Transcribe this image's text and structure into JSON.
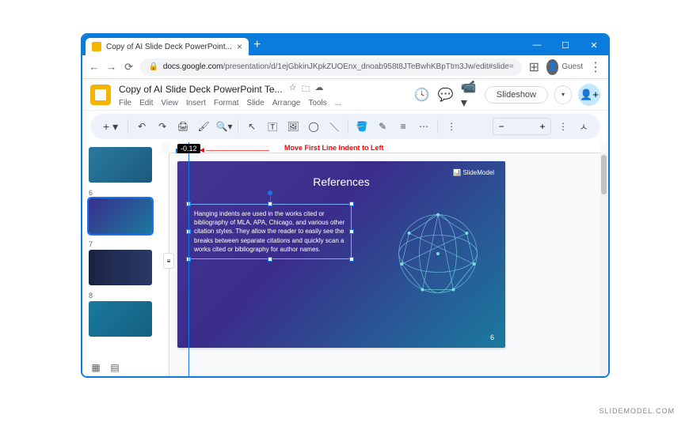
{
  "browser": {
    "tab_title": "Copy of AI Slide Deck PowerPoint...",
    "url_host": "docs.google.com",
    "url_path": "/presentation/d/1ejGbkinJKpkZUOEnx_dnoab958t8JTeBwhKBpTtm3Jw/edit#slide=",
    "guest_label": "Guest"
  },
  "doc": {
    "title": "Copy of AI Slide Deck PowerPoint Te...",
    "menus": [
      "File",
      "Edit",
      "View",
      "Insert",
      "Format",
      "Slide",
      "Arrange",
      "Tools",
      "..."
    ],
    "slideshow_label": "Slideshow"
  },
  "toolbar": {
    "indent_value": "-0.12",
    "zoom_value": ""
  },
  "annotation": {
    "text": "Move First Line Indent to Left",
    "arrow": "◄————————"
  },
  "slide": {
    "title": "References",
    "brand": "📊 SlideModel",
    "body": "Hanging indents are used in the works cited or bibliography of MLA, APA, Chicago, and various other citation styles. They allow the reader to easily see the breaks between separate citations and quickly scan a works cited or bibliography for author names.",
    "page_num": "6"
  },
  "thumbs": {
    "nums": [
      "6",
      "7",
      "8"
    ]
  },
  "watermark": "SLIDEMODEL.COM"
}
